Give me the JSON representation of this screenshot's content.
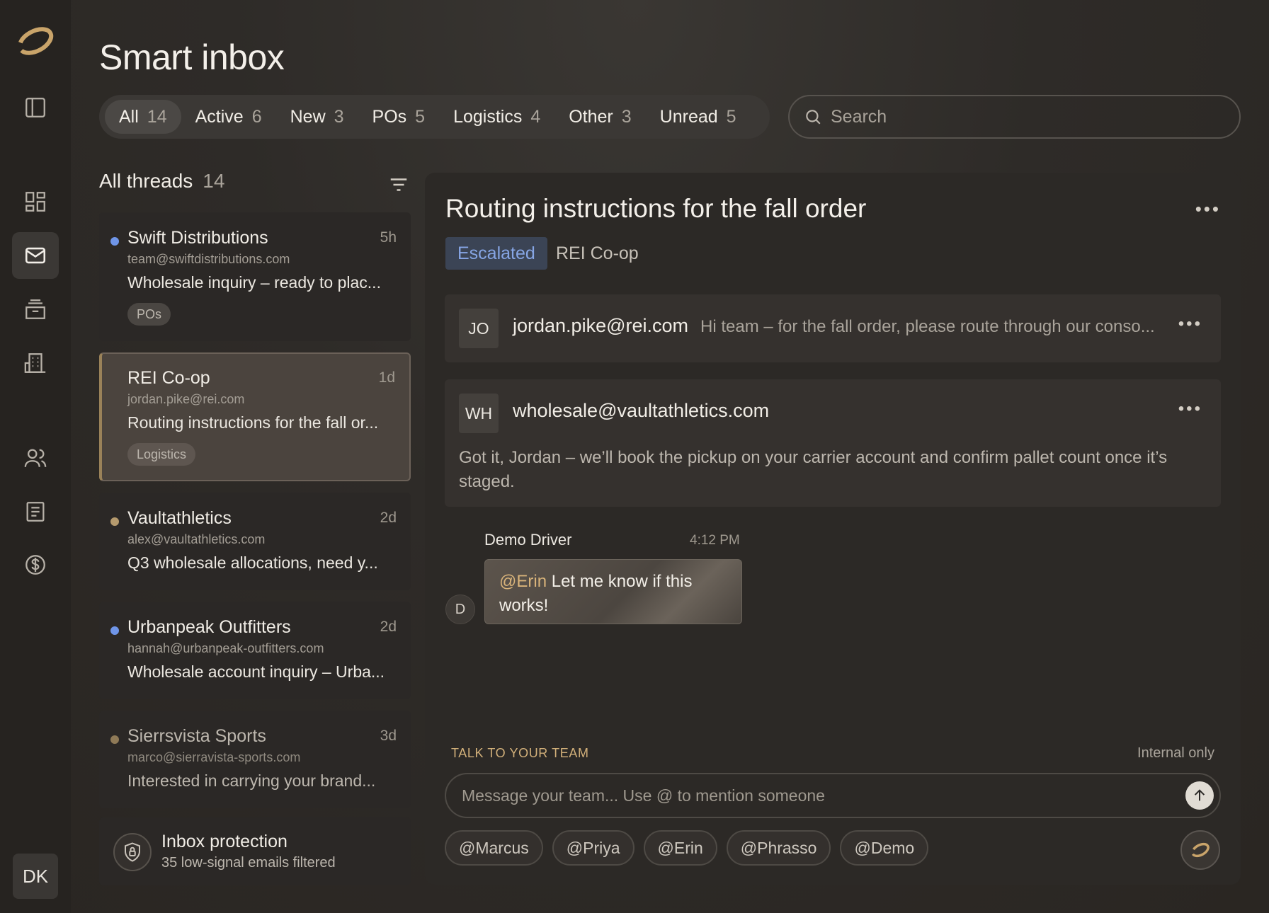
{
  "app": {
    "title": "Smart inbox",
    "user_initials": "DK"
  },
  "nav": [
    {
      "name": "sidebar-toggle",
      "icon": "panel-left-icon"
    },
    {
      "name": "dashboard",
      "icon": "dashboard-icon"
    },
    {
      "name": "inbox",
      "icon": "mail-icon",
      "active": true
    },
    {
      "name": "archive",
      "icon": "archive-icon"
    },
    {
      "name": "companies",
      "icon": "building-icon"
    },
    {
      "name": "contacts",
      "icon": "users-icon"
    },
    {
      "name": "documents",
      "icon": "document-icon"
    },
    {
      "name": "billing",
      "icon": "dollar-icon"
    }
  ],
  "tabs": [
    {
      "label": "All",
      "count": "14",
      "active": true
    },
    {
      "label": "Active",
      "count": "6"
    },
    {
      "label": "New",
      "count": "3"
    },
    {
      "label": "POs",
      "count": "5"
    },
    {
      "label": "Logistics",
      "count": "4"
    },
    {
      "label": "Other",
      "count": "3"
    },
    {
      "label": "Unread",
      "count": "5"
    }
  ],
  "search": {
    "placeholder": "Search"
  },
  "threads": {
    "title": "All threads",
    "count": "14",
    "items": [
      {
        "name": "Swift Distributions",
        "time": "5h",
        "email": "team@swiftdistributions.com",
        "preview": "Wholesale inquiry – ready to plac...",
        "tag": "POs",
        "dot_color": "#6f95e8"
      },
      {
        "name": "REI Co-op",
        "time": "1d",
        "email": "jordan.pike@rei.com",
        "preview": "Routing instructions for the fall or...",
        "tag": "Logistics",
        "selected": true
      },
      {
        "name": "Vaultathletics",
        "time": "2d",
        "email": "alex@vaultathletics.com",
        "preview": "Q3 wholesale allocations, need y...",
        "dot_color": "#b59a6d"
      },
      {
        "name": "Urbanpeak Outfitters",
        "time": "2d",
        "email": "hannah@urbanpeak-outfitters.com",
        "preview": "Wholesale account inquiry – Urba...",
        "dot_color": "#6f95e8"
      },
      {
        "name": "Sierrsvista Sports",
        "time": "3d",
        "email": "marco@sierravista-sports.com",
        "preview": "Interested in carrying your brand...",
        "dot_color": "#8f7a57"
      }
    ]
  },
  "protection": {
    "title": "Inbox protection",
    "subtitle": "35 low-signal emails filtered"
  },
  "detail": {
    "title": "Routing instructions for the fall order",
    "status": "Escalated",
    "org": "REI Co-op",
    "messages": [
      {
        "initials": "JO",
        "from": "jordan.pike@rei.com",
        "snippet": "Hi team – for the fall order, please route through our conso..."
      },
      {
        "initials": "WH",
        "from": "wholesale@vaultathletics.com",
        "body": "Got it, Jordan – we’ll book the pickup on your carrier account and confirm pallet count once it’s staged."
      }
    ],
    "chat": {
      "author": "Demo Driver",
      "time": "4:12 PM",
      "mention": "@Erin",
      "text": " Let me know if this works!",
      "avatar": "D"
    },
    "team": {
      "label": "TALK TO YOUR TEAM",
      "note": "Internal only",
      "placeholder": "Message your team... Use @ to mention someone",
      "mentions": [
        "@Marcus",
        "@Priya",
        "@Erin",
        "@Phrasso",
        "@Demo"
      ]
    }
  }
}
